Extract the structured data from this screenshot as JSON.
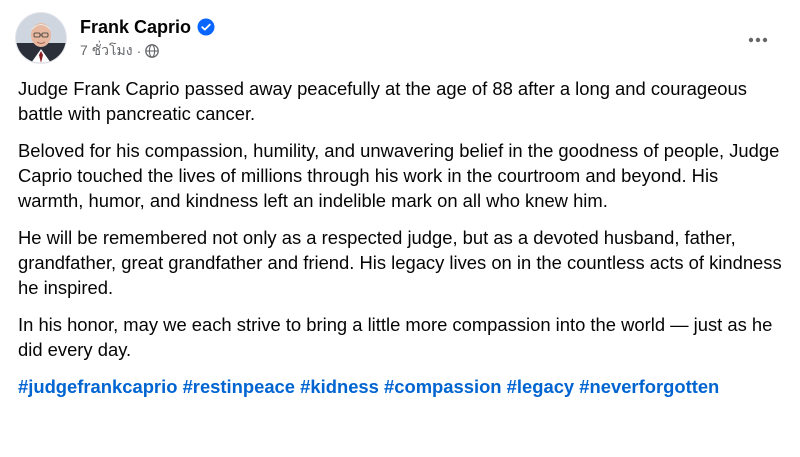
{
  "post": {
    "author": "Frank Caprio",
    "time": "7 ชั่วโมง",
    "separator": "·",
    "paragraphs": [
      "Judge Frank Caprio passed away peacefully at the age of 88 after a long and courageous battle with pancreatic cancer.",
      "Beloved for his compassion, humility, and unwavering belief in the goodness of people, Judge Caprio touched the lives of millions through his work in the courtroom and beyond. His warmth, humor, and kindness left an indelible mark on all who knew him.",
      "He will be remembered not only as a respected judge, but as a devoted husband, father, grandfather, great grandfather and friend. His legacy lives on in the countless acts of kindness he inspired.",
      "In his honor, may we each strive to bring a little more compassion into the world — just as he did every day."
    ],
    "hashtags": [
      "#judgefrankcaprio",
      "#restinpeace",
      "#kidness",
      "#compassion",
      "#legacy",
      "#neverforgotten"
    ]
  },
  "icons": {
    "verified": "verified-badge-icon",
    "audience": "globe-icon",
    "more": "more-options-icon"
  },
  "colors": {
    "text": "#050505",
    "meta": "#65676b",
    "hashtag": "#0064d1",
    "verified": "#0866ff"
  }
}
